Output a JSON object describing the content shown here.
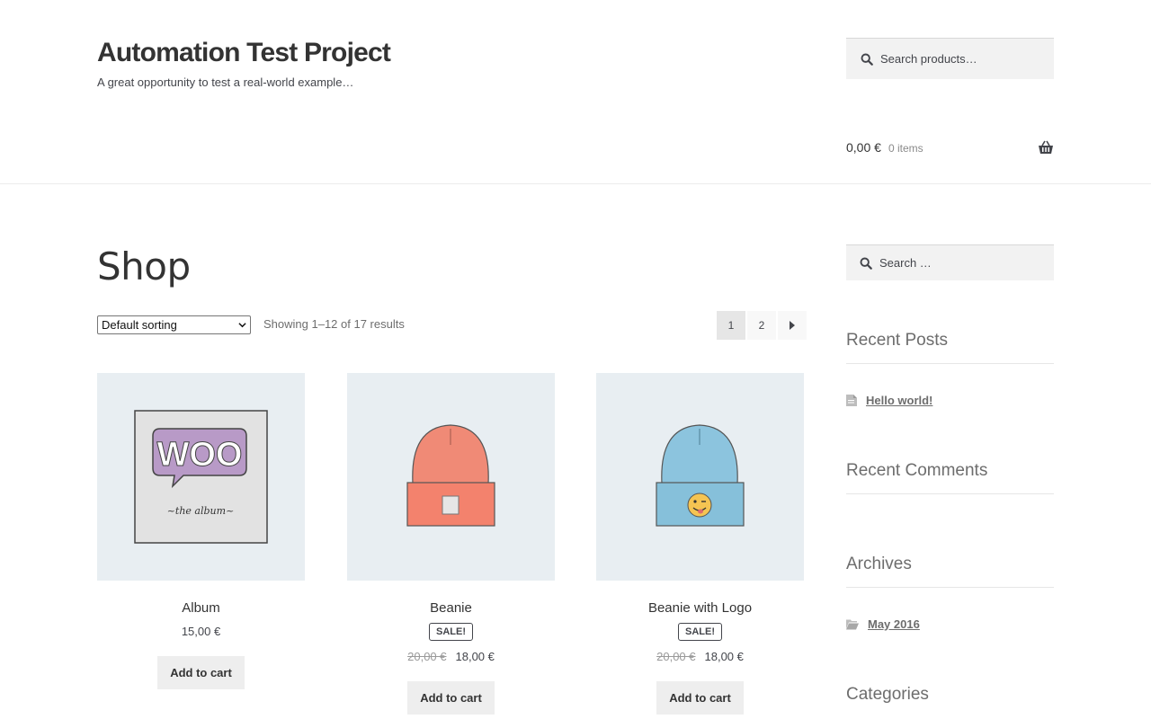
{
  "header": {
    "site_title": "Automation Test Project",
    "site_description": "A great opportunity to test a real-world example…",
    "search_placeholder": "Search products…",
    "cart_amount": "0,00 €",
    "cart_count": "0 items"
  },
  "shop": {
    "title": "Shop",
    "sort_selected": "Default sorting",
    "result_count": "Showing 1–12 of 17 results",
    "pagination": [
      "1",
      "2"
    ],
    "current_page": "1"
  },
  "products": [
    {
      "name": "Album",
      "price": "15,00 €",
      "sale": false,
      "button": "Add to cart"
    },
    {
      "name": "Beanie",
      "sale_label": "SALE!",
      "old_price": "20,00 €",
      "price": "18,00 €",
      "sale": true,
      "button": "Add to cart"
    },
    {
      "name": "Beanie with Logo",
      "sale_label": "SALE!",
      "old_price": "20,00 €",
      "price": "18,00 €",
      "sale": true,
      "button": "Add to cart"
    }
  ],
  "sidebar": {
    "search_placeholder": "Search …",
    "recent_posts_title": "Recent Posts",
    "recent_posts": [
      "Hello world!"
    ],
    "recent_comments_title": "Recent Comments",
    "archives_title": "Archives",
    "archives": [
      "May 2016"
    ],
    "categories_title": "Categories"
  },
  "colors": {
    "accent": "#333333",
    "thumb_bg": "#e8eef2",
    "button_bg": "#eeeeee"
  }
}
